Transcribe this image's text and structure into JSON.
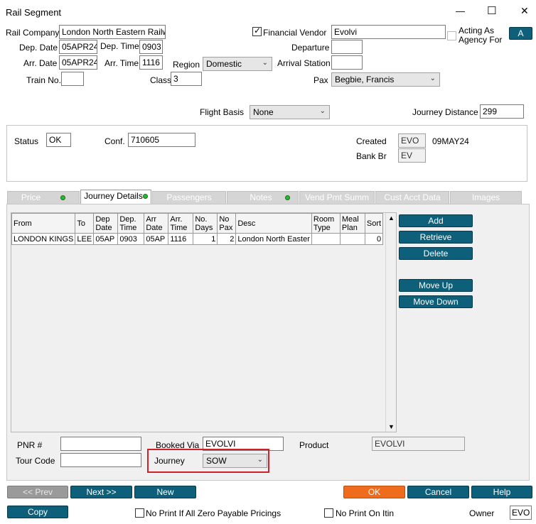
{
  "window": {
    "title": "Rail Segment",
    "minimize": "—",
    "maximize": "☐",
    "close": "✕"
  },
  "fields": {
    "rail_company_label": "Rail Company",
    "rail_company": "London North Eastern Railw",
    "dep_date_label": "Dep. Date",
    "dep_date": "05APR24",
    "dep_time_label": "Dep. Time",
    "dep_time": "0903",
    "arr_date_label": "Arr. Date",
    "arr_date": "05APR24",
    "arr_time_label": "Arr. Time",
    "arr_time": "1116",
    "region_label": "Region",
    "region": "Domestic",
    "train_no_label": "Train No.",
    "train_no": "",
    "class_label": "Class",
    "class": "3",
    "financial_vendor_label": "Financial Vendor",
    "financial_vendor": "Evolvi",
    "departure_label": "Departure",
    "departure": "",
    "arrival_station_label": "Arrival Station",
    "arrival_station": "",
    "pax_label": "Pax",
    "pax": "Begbie, Francis",
    "acting_as_agency_line1": "Acting As",
    "acting_as_agency_line2": "Agency For",
    "a_button": "A",
    "flight_basis_label": "Flight Basis",
    "flight_basis": "None",
    "journey_distance_label": "Journey Distance",
    "journey_distance": "299"
  },
  "status_box": {
    "status_label": "Status",
    "status": "OK",
    "conf_label": "Conf.",
    "conf": "710605",
    "created_label": "Created",
    "created_by": "EVO",
    "created_date": "09MAY24",
    "bank_br_label": "Bank Br",
    "bank_br": "EV"
  },
  "tabs": [
    "Price",
    "Journey Details",
    "Passengers",
    "Notes",
    "Vend Pmt Summ",
    "Cust Acct Data",
    "Images"
  ],
  "grid": {
    "headers": [
      "From",
      "To",
      "Dep Date",
      "Dep. Time",
      "Arr Date",
      "Arr. Time",
      "No. Days",
      "No Pax",
      "Desc",
      "Room Type",
      "Meal Plan",
      "Sort"
    ],
    "rows": [
      [
        "LONDON KINGS",
        "LEE",
        "05AP",
        "0903",
        "05AP",
        "1116",
        "1",
        "2",
        "London North Easter",
        "",
        "",
        "0"
      ]
    ]
  },
  "side_buttons": {
    "add": "Add",
    "retrieve": "Retrieve",
    "delete": "Delete",
    "move_up": "Move Up",
    "move_down": "Move Down"
  },
  "bottom_fields": {
    "pnr_label": "PNR #",
    "pnr": "",
    "tour_code_label": "Tour Code",
    "tour_code": "",
    "booked_via_label": "Booked Via",
    "booked_via": "EVOLVI",
    "journey_label": "Journey",
    "journey": "SOW",
    "product_label": "Product",
    "product": "EVOLVI"
  },
  "nav_buttons": {
    "prev": "<< Prev",
    "next": "Next >>",
    "new": "New",
    "ok": "OK",
    "cancel": "Cancel",
    "help": "Help",
    "copy": "Copy"
  },
  "footer": {
    "no_print_zero_label": "No Print If All Zero Payable Pricings",
    "no_print_itin_label": "No Print On Itin",
    "owner_label": "Owner",
    "owner": "EVO"
  },
  "colors": {
    "button_teal": "#0e5f7a",
    "ok_orange": "#ef6c1c",
    "highlight_red": "#d0202a",
    "panel_gray": "#f0f0f0"
  }
}
